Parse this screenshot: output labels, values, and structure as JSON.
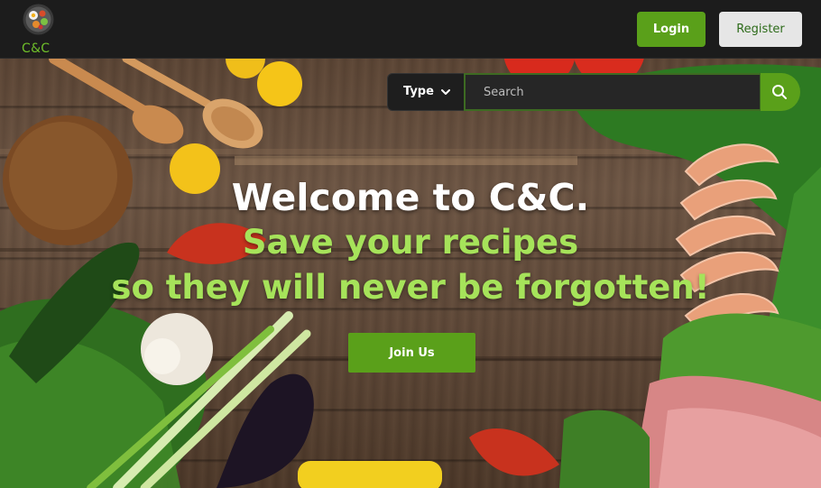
{
  "header": {
    "brand_text": "C&C",
    "login_label": "Login",
    "register_label": "Register"
  },
  "search": {
    "type_label": "Type",
    "placeholder": "Search"
  },
  "hero": {
    "welcome": "Welcome to C&C.",
    "tagline_line1": "Save your recipes",
    "tagline_line2": "so they will never be forgotten!",
    "join_label": "Join Us"
  },
  "icons": {
    "logo": "food-plate-icon",
    "type_dropdown": "chevron-down-icon",
    "search": "search-icon"
  },
  "colors": {
    "accent_green": "#5aa01a",
    "headline_green": "#a6e35a",
    "topbar": "#1c1c1c"
  }
}
